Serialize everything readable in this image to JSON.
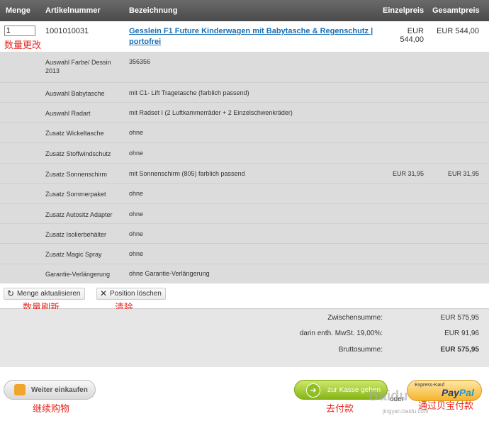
{
  "header": {
    "qty": "Menge",
    "artno": "Artikelnummer",
    "desc": "Bezeichnung",
    "unit_price": "Einzelpreis",
    "total_price": "Gesamtpreis"
  },
  "product": {
    "qty_value": "1",
    "artno": "1001010031",
    "name": "Gesslein F1 Future Kinderwagen mit Babytasche & Regenschutz | portofrei",
    "unit_price": "EUR 544,00",
    "total_price": "EUR 544,00"
  },
  "options": [
    {
      "label": "Auswahl Farbe/ Dessin 2013",
      "value": "356356",
      "p1": "",
      "p2": ""
    },
    {
      "label": "Auswahl Babytasche",
      "value": "mit C1- Lift Tragetasche (farblich passend)",
      "p1": "",
      "p2": ""
    },
    {
      "label": "Auswahl Radart",
      "value": "mit Radset I (2 Luftkammerräder + 2 Einzelschwenkräder)",
      "p1": "",
      "p2": ""
    },
    {
      "label": "Zusatz Wickeltasche",
      "value": "ohne",
      "p1": "",
      "p2": ""
    },
    {
      "label": "Zusatz Stoffwindschutz",
      "value": "ohne",
      "p1": "",
      "p2": ""
    },
    {
      "label": "Zusatz Sonnenschirm",
      "value": "mit Sonnenschirm (805) farblich passend",
      "p1": "EUR 31,95",
      "p2": "EUR 31,95"
    },
    {
      "label": "Zusatz Sommerpaket",
      "value": "ohne",
      "p1": "",
      "p2": ""
    },
    {
      "label": "Zusatz Autositz Adapter",
      "value": "ohne",
      "p1": "",
      "p2": ""
    },
    {
      "label": "Zusatz Isolierbehälter",
      "value": "ohne",
      "p1": "",
      "p2": ""
    },
    {
      "label": "Zusatz Magic Spray",
      "value": "ohne",
      "p1": "",
      "p2": ""
    },
    {
      "label": "Garantie-Verlängerung",
      "value": "ohne Garantie-Verlängerung",
      "p1": "",
      "p2": ""
    }
  ],
  "actions": {
    "update": "Menge aktualisieren",
    "delete": "Position löschen"
  },
  "annotations": {
    "qty_change": "数量更改",
    "qty_refresh": "数量刷新",
    "clear": "清除",
    "continue": "继续购物",
    "checkout": "去付款",
    "paypal": "通过贝宝付款"
  },
  "totals": {
    "subtotal_label": "Zwischensumme:",
    "subtotal_value": "EUR 575,95",
    "vat_label": "darin enth. MwSt. 19,00%:",
    "vat_value": "EUR 91,96",
    "gross_label": "Bruttosumme:",
    "gross_value": "EUR 575,95"
  },
  "footer": {
    "continue_label": "Weiter einkaufen",
    "checkout_label": "zur Kasse gehen",
    "or_label": "oder",
    "paypal_small": "Express-Kauf",
    "paypal_brand_a": "Pay",
    "paypal_brand_b": "Pal",
    "baidu": "Baidu",
    "baidu_sub": "jingyan.baidu.com"
  },
  "colors": {
    "header_bg": "#555555",
    "link": "#1a6fb4",
    "annotation": "#e8261f",
    "checkout_green": "#86b516"
  }
}
